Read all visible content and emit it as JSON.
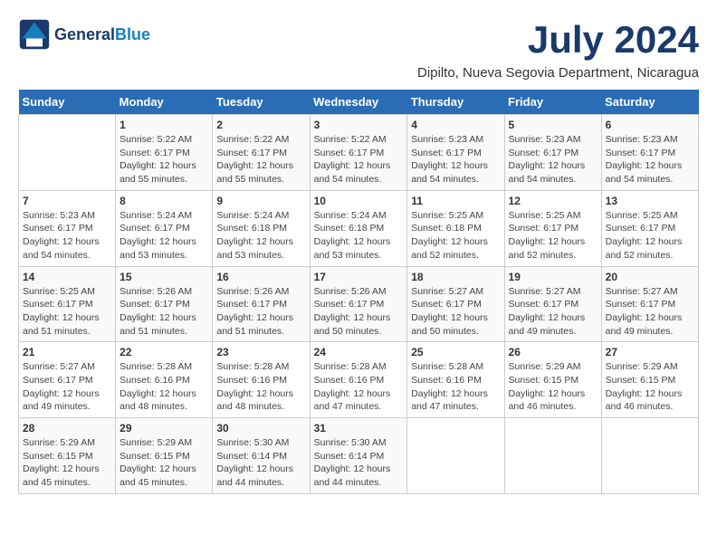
{
  "header": {
    "logo_text_general": "General",
    "logo_text_blue": "Blue",
    "month_title": "July 2024",
    "location": "Dipilto, Nueva Segovia Department, Nicaragua"
  },
  "calendar": {
    "days_of_week": [
      "Sunday",
      "Monday",
      "Tuesday",
      "Wednesday",
      "Thursday",
      "Friday",
      "Saturday"
    ],
    "weeks": [
      [
        {
          "day": "",
          "info": ""
        },
        {
          "day": "1",
          "info": "Sunrise: 5:22 AM\nSunset: 6:17 PM\nDaylight: 12 hours\nand 55 minutes."
        },
        {
          "day": "2",
          "info": "Sunrise: 5:22 AM\nSunset: 6:17 PM\nDaylight: 12 hours\nand 55 minutes."
        },
        {
          "day": "3",
          "info": "Sunrise: 5:22 AM\nSunset: 6:17 PM\nDaylight: 12 hours\nand 54 minutes."
        },
        {
          "day": "4",
          "info": "Sunrise: 5:23 AM\nSunset: 6:17 PM\nDaylight: 12 hours\nand 54 minutes."
        },
        {
          "day": "5",
          "info": "Sunrise: 5:23 AM\nSunset: 6:17 PM\nDaylight: 12 hours\nand 54 minutes."
        },
        {
          "day": "6",
          "info": "Sunrise: 5:23 AM\nSunset: 6:17 PM\nDaylight: 12 hours\nand 54 minutes."
        }
      ],
      [
        {
          "day": "7",
          "info": "Sunrise: 5:23 AM\nSunset: 6:17 PM\nDaylight: 12 hours\nand 54 minutes."
        },
        {
          "day": "8",
          "info": "Sunrise: 5:24 AM\nSunset: 6:17 PM\nDaylight: 12 hours\nand 53 minutes."
        },
        {
          "day": "9",
          "info": "Sunrise: 5:24 AM\nSunset: 6:18 PM\nDaylight: 12 hours\nand 53 minutes."
        },
        {
          "day": "10",
          "info": "Sunrise: 5:24 AM\nSunset: 6:18 PM\nDaylight: 12 hours\nand 53 minutes."
        },
        {
          "day": "11",
          "info": "Sunrise: 5:25 AM\nSunset: 6:18 PM\nDaylight: 12 hours\nand 52 minutes."
        },
        {
          "day": "12",
          "info": "Sunrise: 5:25 AM\nSunset: 6:17 PM\nDaylight: 12 hours\nand 52 minutes."
        },
        {
          "day": "13",
          "info": "Sunrise: 5:25 AM\nSunset: 6:17 PM\nDaylight: 12 hours\nand 52 minutes."
        }
      ],
      [
        {
          "day": "14",
          "info": "Sunrise: 5:25 AM\nSunset: 6:17 PM\nDaylight: 12 hours\nand 51 minutes."
        },
        {
          "day": "15",
          "info": "Sunrise: 5:26 AM\nSunset: 6:17 PM\nDaylight: 12 hours\nand 51 minutes."
        },
        {
          "day": "16",
          "info": "Sunrise: 5:26 AM\nSunset: 6:17 PM\nDaylight: 12 hours\nand 51 minutes."
        },
        {
          "day": "17",
          "info": "Sunrise: 5:26 AM\nSunset: 6:17 PM\nDaylight: 12 hours\nand 50 minutes."
        },
        {
          "day": "18",
          "info": "Sunrise: 5:27 AM\nSunset: 6:17 PM\nDaylight: 12 hours\nand 50 minutes."
        },
        {
          "day": "19",
          "info": "Sunrise: 5:27 AM\nSunset: 6:17 PM\nDaylight: 12 hours\nand 49 minutes."
        },
        {
          "day": "20",
          "info": "Sunrise: 5:27 AM\nSunset: 6:17 PM\nDaylight: 12 hours\nand 49 minutes."
        }
      ],
      [
        {
          "day": "21",
          "info": "Sunrise: 5:27 AM\nSunset: 6:17 PM\nDaylight: 12 hours\nand 49 minutes."
        },
        {
          "day": "22",
          "info": "Sunrise: 5:28 AM\nSunset: 6:16 PM\nDaylight: 12 hours\nand 48 minutes."
        },
        {
          "day": "23",
          "info": "Sunrise: 5:28 AM\nSunset: 6:16 PM\nDaylight: 12 hours\nand 48 minutes."
        },
        {
          "day": "24",
          "info": "Sunrise: 5:28 AM\nSunset: 6:16 PM\nDaylight: 12 hours\nand 47 minutes."
        },
        {
          "day": "25",
          "info": "Sunrise: 5:28 AM\nSunset: 6:16 PM\nDaylight: 12 hours\nand 47 minutes."
        },
        {
          "day": "26",
          "info": "Sunrise: 5:29 AM\nSunset: 6:15 PM\nDaylight: 12 hours\nand 46 minutes."
        },
        {
          "day": "27",
          "info": "Sunrise: 5:29 AM\nSunset: 6:15 PM\nDaylight: 12 hours\nand 46 minutes."
        }
      ],
      [
        {
          "day": "28",
          "info": "Sunrise: 5:29 AM\nSunset: 6:15 PM\nDaylight: 12 hours\nand 45 minutes."
        },
        {
          "day": "29",
          "info": "Sunrise: 5:29 AM\nSunset: 6:15 PM\nDaylight: 12 hours\nand 45 minutes."
        },
        {
          "day": "30",
          "info": "Sunrise: 5:30 AM\nSunset: 6:14 PM\nDaylight: 12 hours\nand 44 minutes."
        },
        {
          "day": "31",
          "info": "Sunrise: 5:30 AM\nSunset: 6:14 PM\nDaylight: 12 hours\nand 44 minutes."
        },
        {
          "day": "",
          "info": ""
        },
        {
          "day": "",
          "info": ""
        },
        {
          "day": "",
          "info": ""
        }
      ]
    ]
  }
}
